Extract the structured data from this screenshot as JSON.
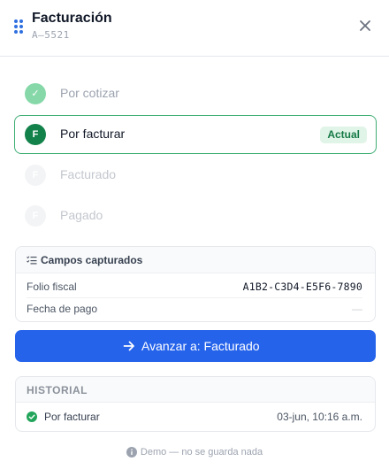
{
  "header": {
    "title": "Facturación",
    "subtitle": "A–5521",
    "grip_icon": "grip-dots-icon",
    "close_icon": "close-icon"
  },
  "steps": [
    {
      "label": "Por cotizar",
      "state": "done",
      "marker": "✓"
    },
    {
      "label": "Por facturar",
      "state": "current",
      "marker": "F",
      "badge": "Actual"
    },
    {
      "label": "Facturado",
      "state": "future",
      "marker": "F"
    },
    {
      "label": "Pagado",
      "state": "future",
      "marker": "F"
    }
  ],
  "fields": {
    "title": "Campos capturados",
    "icon": "checklist-icon",
    "rows": [
      {
        "key": "Folio fiscal",
        "value": "A1B2-C3D4-E5F6-7890"
      },
      {
        "key": "Fecha de pago",
        "value": "—"
      }
    ]
  },
  "action": {
    "label": "Avanzar a: Facturado",
    "icon": "arrow-right-icon"
  },
  "history": {
    "title": "HISTORIAL",
    "items": [
      {
        "label": "Por facturar",
        "time": "03-jun, 10:16 a.m.",
        "icon": "check-circle-icon"
      }
    ]
  },
  "footer": {
    "text": "Demo — no se guarda nada",
    "icon": "info-icon"
  },
  "colors": {
    "primary": "#2563eb",
    "success": "#13824a",
    "success_light": "#86d8a9",
    "badge_bg": "#e1f4e8"
  }
}
